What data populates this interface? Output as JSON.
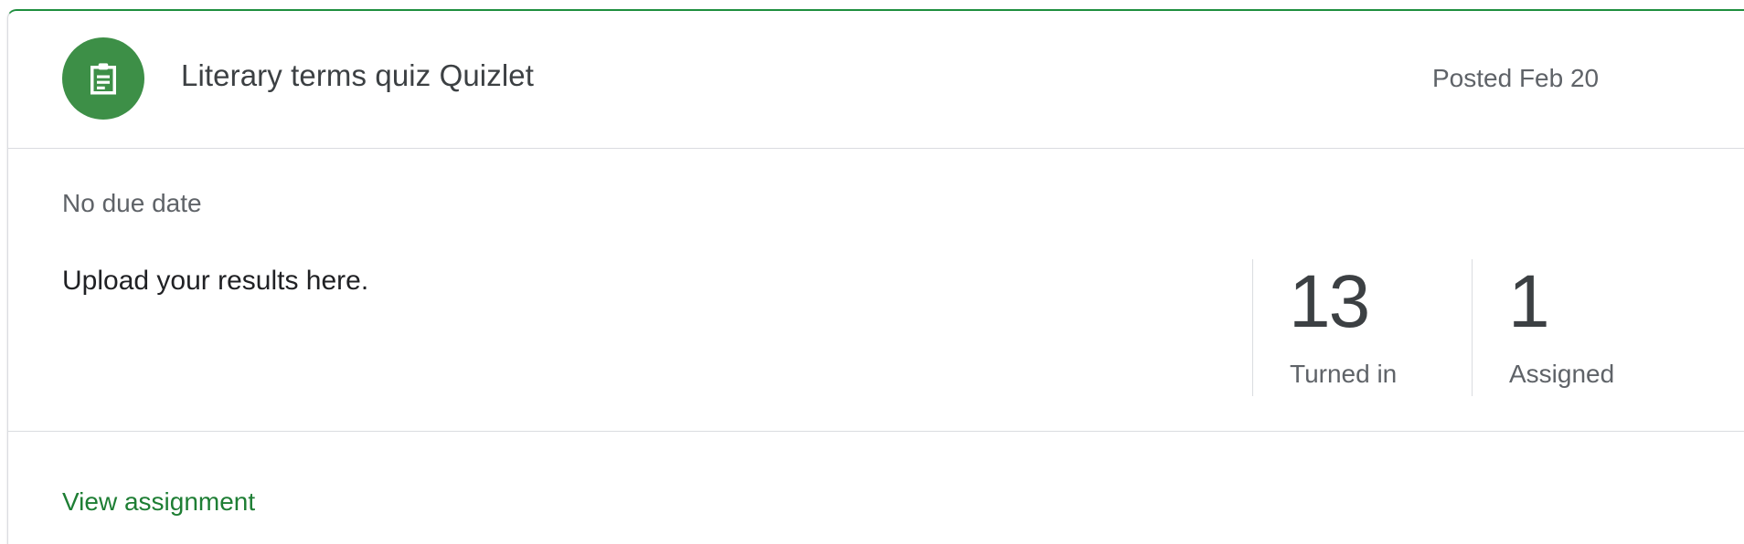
{
  "assignment": {
    "title": "Literary terms quiz Quizlet",
    "posted": "Posted Feb 20",
    "due": "No due date",
    "description": "Upload your results here.",
    "icon": "assignment-clipboard-icon",
    "icon_color": "#3d8f47",
    "stats": [
      {
        "value": "13",
        "label": "Turned in"
      },
      {
        "value": "1",
        "label": "Assigned"
      }
    ],
    "view_link": "View assignment",
    "link_color": "#1e7e34"
  }
}
